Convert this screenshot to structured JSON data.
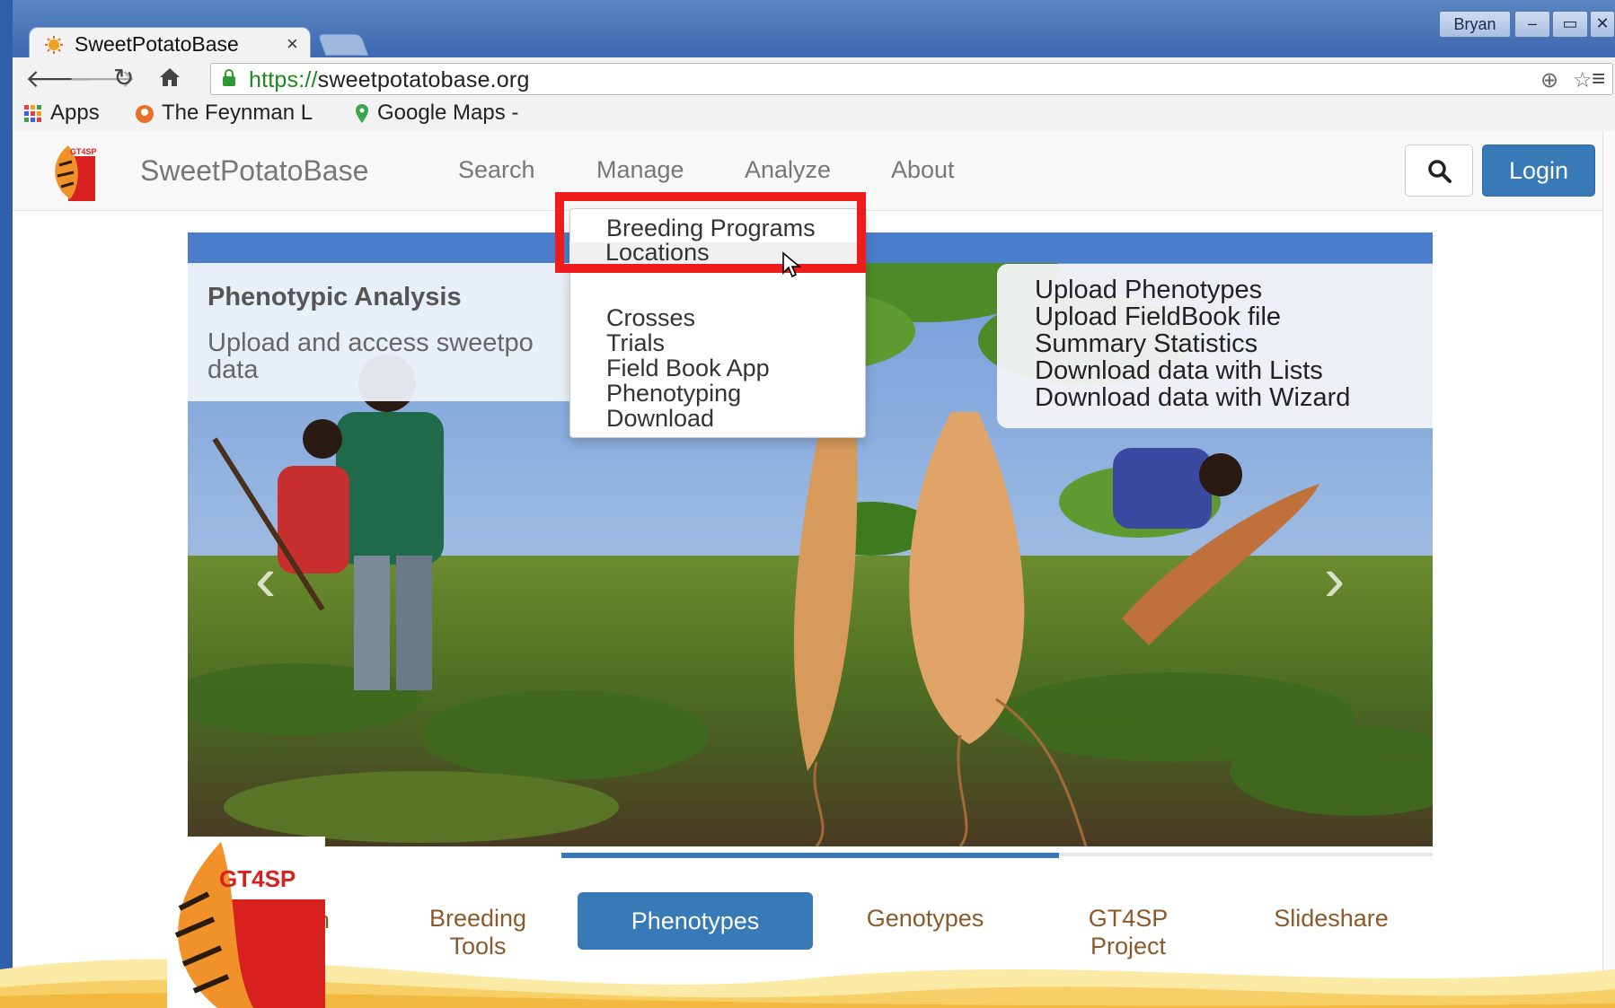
{
  "browser": {
    "tab_title": "SweetPotatoBase",
    "tab_close": "×",
    "user": "Bryan",
    "window_buttons": [
      "–",
      "▭",
      "✕"
    ],
    "url_protocol": "https://",
    "url_host": "sweetpotatobase.org",
    "bookmarks": [
      {
        "label": "Apps",
        "icon": "apps-grid-icon"
      },
      {
        "label": "The Feynman L",
        "icon": "feynman-favicon"
      },
      {
        "label": "Google Maps -",
        "icon": "maps-pin-icon"
      }
    ]
  },
  "site": {
    "brand": "SweetPotatoBase",
    "nav": [
      "Search",
      "Manage",
      "Analyze",
      "About"
    ],
    "login": "Login"
  },
  "dropdown": {
    "items": [
      "Breeding Programs",
      "Locations",
      "Crosses",
      "Trials",
      "Field Book App",
      "Phenotyping",
      "Download"
    ]
  },
  "carousel": {
    "heading": "Phenotypic Analysis",
    "text": "Upload and access sweetpo data",
    "features": [
      "Upload Phenotypes",
      "Upload FieldBook file",
      "Summary Statistics",
      "Download data with Lists",
      "Download data with Wizard"
    ],
    "prev": "‹",
    "next": "›"
  },
  "bottom_tabs": {
    "partial": "n",
    "items": [
      "Breeding Tools",
      "Phenotypes",
      "Genotypes",
      "GT4SP Project",
      "Slideshare"
    ],
    "active": "Phenotypes",
    "progress": 0.57
  },
  "logo_text": "GT4SP",
  "colors": {
    "accent": "#3879b8",
    "highlight": "#ee1c1c",
    "tab_text": "#8a5a2a"
  }
}
